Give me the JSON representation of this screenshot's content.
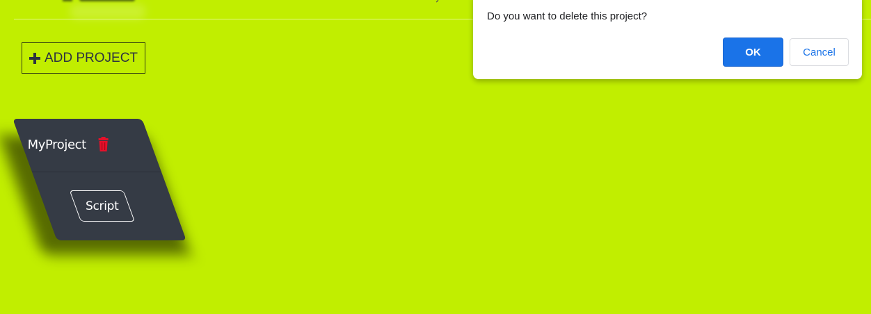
{
  "colors": {
    "page_background": "#c1ee00",
    "card_background": "#353b45",
    "trash_red": "#e5102a",
    "dialog_ok_blue": "#1a73e8"
  },
  "toolbar": {
    "add_project_label": "ADD PROJECT",
    "add_icon": "plus-icon"
  },
  "projects": [
    {
      "name": "MyProject",
      "delete_icon": "trash-icon",
      "script_label": "Script"
    }
  ],
  "dialog": {
    "message": "Do you want to delete this project?",
    "ok_label": "OK",
    "cancel_label": "Cancel"
  }
}
